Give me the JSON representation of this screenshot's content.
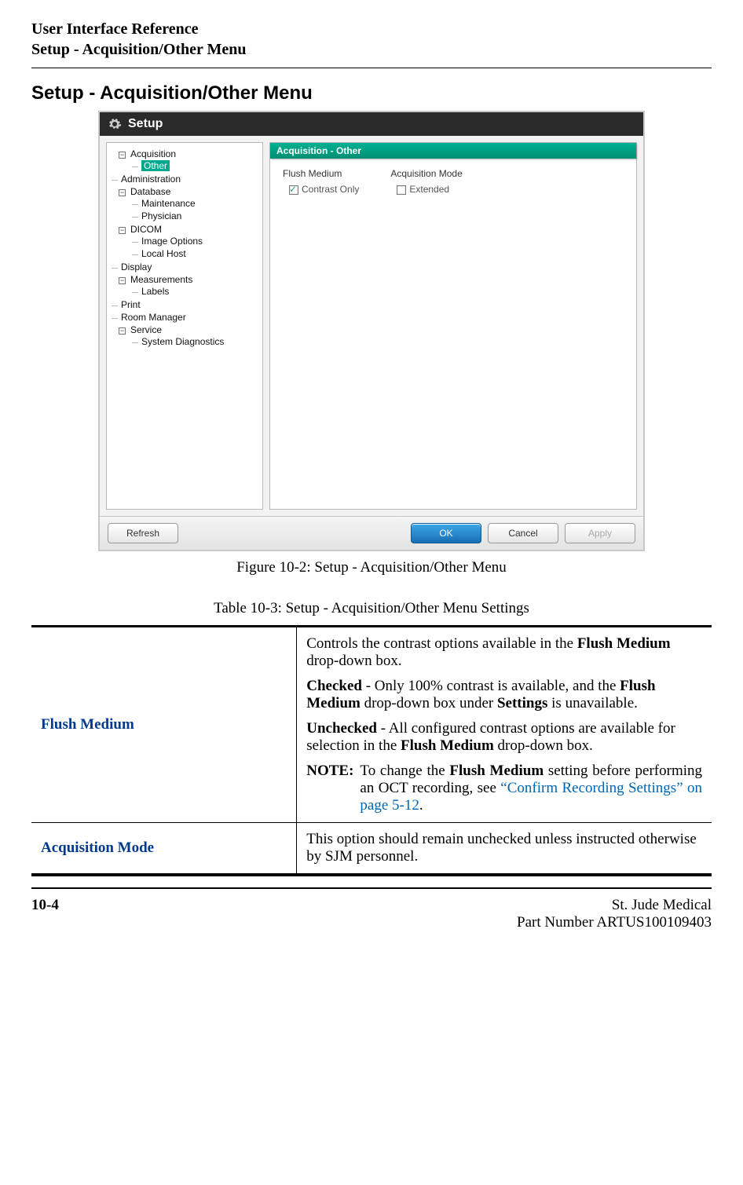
{
  "header": {
    "line1": "User Interface Reference",
    "line2": "Setup - Acquisition/Other Menu"
  },
  "section_title": "Setup - Acquisition/Other Menu",
  "setup": {
    "title": "Setup",
    "tree": {
      "acquisition": "Acquisition",
      "other": "Other",
      "administration": "Administration",
      "database": "Database",
      "maintenance": "Maintenance",
      "physician": "Physician",
      "dicom": "DICOM",
      "image_options": "Image Options",
      "local_host": "Local Host",
      "display": "Display",
      "measurements": "Measurements",
      "labels": "Labels",
      "print": "Print",
      "room_manager": "Room Manager",
      "service": "Service",
      "system_diagnostics": "System Diagnostics"
    },
    "group_header": "Acquisition - Other",
    "flush_medium_label": "Flush Medium",
    "contrast_only_label": "Contrast Only",
    "acquisition_mode_label": "Acquisition Mode",
    "extended_label": "Extended",
    "buttons": {
      "refresh": "Refresh",
      "ok": "OK",
      "cancel": "Cancel",
      "apply": "Apply"
    }
  },
  "figure_caption": "Figure 10-2:  Setup - Acquisition/Other Menu",
  "table_caption": "Table 10-3:  Setup - Acquisition/Other Menu Settings",
  "table": {
    "row1": {
      "label": "Flush Medium",
      "p1a": "Controls the contrast options available in the ",
      "p1b": "Flush Medium",
      "p1c": " drop-down box.",
      "p2a": "Checked",
      "p2b": " - Only 100% contrast is available, and the ",
      "p2c": "Flush Medium",
      "p2d": " drop-down box under ",
      "p2e": "Settings",
      "p2f": " is unavailable.",
      "p3a": "Unchecked",
      "p3b": " - All configured contrast options are available for selection in the ",
      "p3c": "Flush Medium",
      "p3d": " drop-down box.",
      "note_label": "NOTE:",
      "note_a": "To change the ",
      "note_b": "Flush Medium",
      "note_c": " setting before performing an OCT recording, see ",
      "note_link": "“Confirm Recording Settings” on page 5-12",
      "note_d": "."
    },
    "row2": {
      "label": "Acquisition Mode",
      "text": "This option should remain unchecked unless instructed otherwise by SJM personnel."
    }
  },
  "footer": {
    "page": "10-4",
    "company": "St. Jude Medical",
    "part": "Part Number ARTUS100109403"
  }
}
